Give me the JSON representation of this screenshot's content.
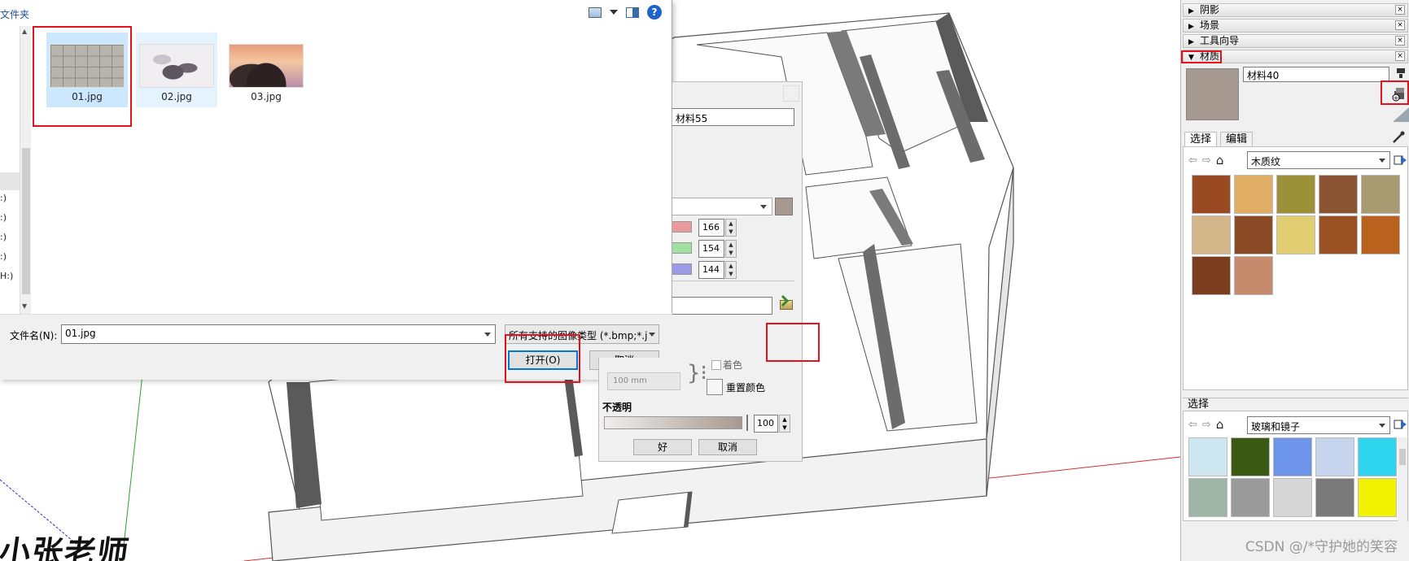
{
  "file_dialog": {
    "breadcrumb": "文件夹",
    "drives": [
      ":)",
      ":)",
      ":)",
      ":)",
      "H:)"
    ],
    "files": [
      {
        "name": "01.jpg",
        "thumb": "tiles"
      },
      {
        "name": "02.jpg",
        "thumb": "painting"
      },
      {
        "name": "03.jpg",
        "thumb": "sunset"
      }
    ],
    "filename_label": "文件名(N):",
    "filename_value": "01.jpg",
    "filetype_value": "所有支持的图像类型 (*.bmp;*.j",
    "open_button": "打开(O)",
    "cancel_button": "取消"
  },
  "material_dialog": {
    "name": "材料55",
    "color_preview": "#a69a90",
    "rgb": [
      {
        "channel": "red",
        "value": "166",
        "color": "#e99a9a"
      },
      {
        "channel": "green",
        "value": "154",
        "color": "#9fdf9f"
      },
      {
        "channel": "blue",
        "value": "144",
        "color": "#9a9ae6"
      }
    ],
    "size_placeholder": "100 mm",
    "colorize_label": "着色",
    "reset_color_label": "重置颜色",
    "opacity_label": "不透明",
    "opacity_value": "100",
    "ok_button": "好",
    "cancel_button": "取消"
  },
  "tray": {
    "panels": [
      {
        "label": "阴影",
        "expanded": false
      },
      {
        "label": "场景",
        "expanded": false
      },
      {
        "label": "工具向导",
        "expanded": false
      },
      {
        "label": "材质",
        "expanded": true
      }
    ],
    "material_name": "材料40",
    "material_color": "#a69a90",
    "tabs": [
      "选择",
      "编辑"
    ],
    "library": "木质纹",
    "wood_swatches": [
      "#9a4a22",
      "#e0ad64",
      "#9b9138",
      "#8b5432",
      "#a89b71",
      "#d3b78a",
      "#8a4a26",
      "#e1cd72",
      "#9a5224",
      "#b8621e",
      "#7a3d1e",
      "#c58b6c"
    ],
    "secondary_title": "选择",
    "secondary_library": "玻璃和镜子",
    "glass_swatches": [
      "#cde6ef",
      "#3a5a14",
      "#6c94e8",
      "#c7d4ee",
      "#2fd4ee",
      "#9fb5a8",
      "#9a9a9a",
      "#d6d6d6",
      "#7a7a7a",
      "#f2f200"
    ]
  },
  "watermark": {
    "logo": "小张老师",
    "csdn": "CSDN @/*守护她的笑容"
  },
  "colors": {
    "accent_highlight": "#e3121c",
    "selection_blue": "#cce8ff",
    "default_button_border": "#0078d7"
  }
}
